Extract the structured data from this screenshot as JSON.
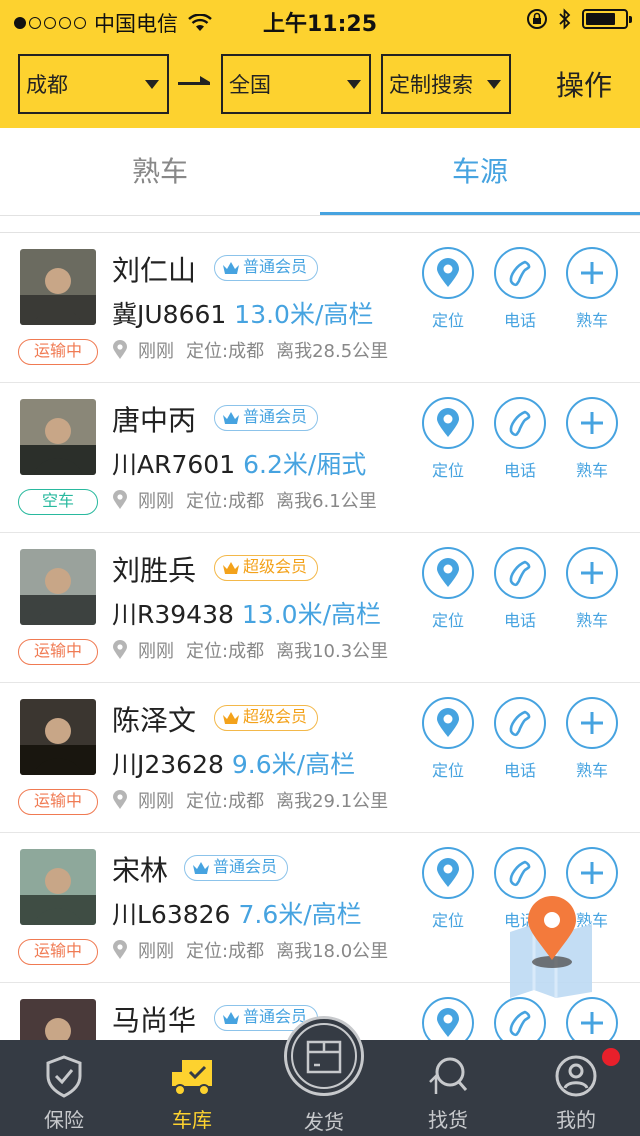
{
  "status_bar": {
    "carrier": "中国电信",
    "time": "上午11:25",
    "signal_bars": 1,
    "battery_level": 0.75
  },
  "filters": {
    "from": "成都",
    "to": "全国",
    "custom": "定制搜索",
    "action": "操作"
  },
  "tabs": [
    {
      "label": "熟车",
      "active": false
    },
    {
      "label": "车源",
      "active": true
    }
  ],
  "actions": {
    "locate": "定位",
    "call": "电话",
    "add_fav": "熟车"
  },
  "rows": [
    {
      "name": "刘仁山",
      "badge": "普通会员",
      "badge_type": "normal",
      "plate": "冀JU8661",
      "spec": "13.0米/高栏",
      "time": "刚刚",
      "location": "定位:成都",
      "distance": "离我28.5公里",
      "status": "运输中",
      "status_type": "busy"
    },
    {
      "name": "唐中丙",
      "badge": "普通会员",
      "badge_type": "normal",
      "plate": "川AR7601",
      "spec": "6.2米/厢式",
      "time": "刚刚",
      "location": "定位:成都",
      "distance": "离我6.1公里",
      "status": "空车",
      "status_type": "free"
    },
    {
      "name": "刘胜兵",
      "badge": "超级会员",
      "badge_type": "super",
      "plate": "川R39438",
      "spec": "13.0米/高栏",
      "time": "刚刚",
      "location": "定位:成都",
      "distance": "离我10.3公里",
      "status": "运输中",
      "status_type": "busy"
    },
    {
      "name": "陈泽文",
      "badge": "超级会员",
      "badge_type": "super",
      "plate": "川J23628",
      "spec": "9.6米/高栏",
      "time": "刚刚",
      "location": "定位:成都",
      "distance": "离我29.1公里",
      "status": "运输中",
      "status_type": "busy"
    },
    {
      "name": "宋林",
      "badge": "普通会员",
      "badge_type": "normal",
      "plate": "川L63826",
      "spec": "7.6米/高栏",
      "time": "刚刚",
      "location": "定位:成都",
      "distance": "离我18.0公里",
      "status": "运输中",
      "status_type": "busy"
    },
    {
      "name": "马尚华",
      "badge": "普通会员",
      "badge_type": "normal",
      "plate": "",
      "spec": "",
      "time": "",
      "location": "",
      "distance": "",
      "status": "",
      "status_type": "busy"
    }
  ],
  "bottom_nav": [
    {
      "label": "保险",
      "icon": "shield-check-icon",
      "active": false
    },
    {
      "label": "车库",
      "icon": "truck-icon",
      "active": true
    },
    {
      "label": "发货",
      "icon": "package-icon",
      "active": false
    },
    {
      "label": "找货",
      "icon": "search-icon",
      "active": false
    },
    {
      "label": "我的",
      "icon": "user-icon",
      "active": false,
      "has_notification": true
    }
  ],
  "colors": {
    "header_yellow": "#fdd22f",
    "accent_blue": "#46a3e0",
    "busy_orange": "#f07a52",
    "free_green": "#29b99e",
    "super_gold": "#f3a21b",
    "tabbar_bg": "#353b44",
    "notification_red": "#e8202b"
  }
}
